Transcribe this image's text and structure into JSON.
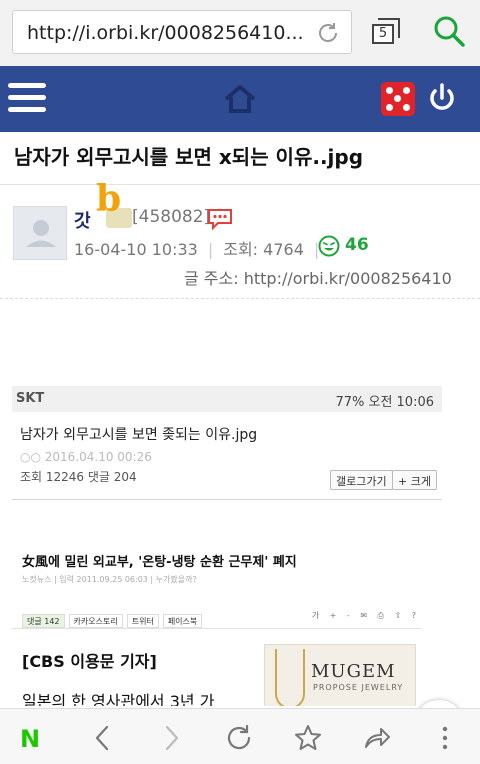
{
  "browser": {
    "url": "http://i.orbi.kr/0008256410...",
    "tab_count": "5"
  },
  "site": {
    "brand_color": "#2e4b93"
  },
  "post": {
    "title": "남자가 외무고시를 보면 x되는 이유..jpg",
    "author": "갓",
    "author_id": "[458082]",
    "date": "16-04-10 10:33",
    "views_label": "조회:",
    "views": "4764",
    "likes": "46",
    "short_url_label": "글 주소:",
    "short_url": "http://orbi.kr/0008256410"
  },
  "embedded": {
    "carrier": "SKT",
    "status_right": "77% 오전 10:06",
    "title": "남자가 외무고시를 보면 좆되는 이유.jpg",
    "date": "○○ 2016.04.10 00:26",
    "stats": "조회 12246 댓글 204",
    "btn_gallery": "갤로그가기",
    "btn_large": "+ 크게",
    "news_title": "女風에 밀린 외교부, '온탕-냉탕 순환 근무제' 폐지",
    "news_meta": "노컷뉴스 | 입력 2011.09.25 06:03 | 누가봤을까?",
    "share_comment": "댓글 142",
    "share_kakao": "카카오스토리",
    "share_twitter": "트위터",
    "share_facebook": "페이스북",
    "tools": "가 + - ✉ ⎙ ⇧ ?",
    "reporter": "[CBS 이용문 기자]",
    "lead": "일본의 한 영사관에서 3년 가",
    "ad_brand": "MUGEM",
    "ad_sub": "PROPOSE JEWELRY"
  },
  "toolbar": {
    "naver": "N"
  },
  "icons": {
    "menu": "hamburger-icon",
    "home": "home-icon",
    "dice": "dice-icon",
    "power": "power-icon",
    "message": "message-icon",
    "smile": "smile-icon",
    "back": "back-icon",
    "forward": "forward-icon",
    "reload": "reload-icon",
    "bookmark": "star-icon",
    "share": "share-icon",
    "more": "more-icon"
  }
}
